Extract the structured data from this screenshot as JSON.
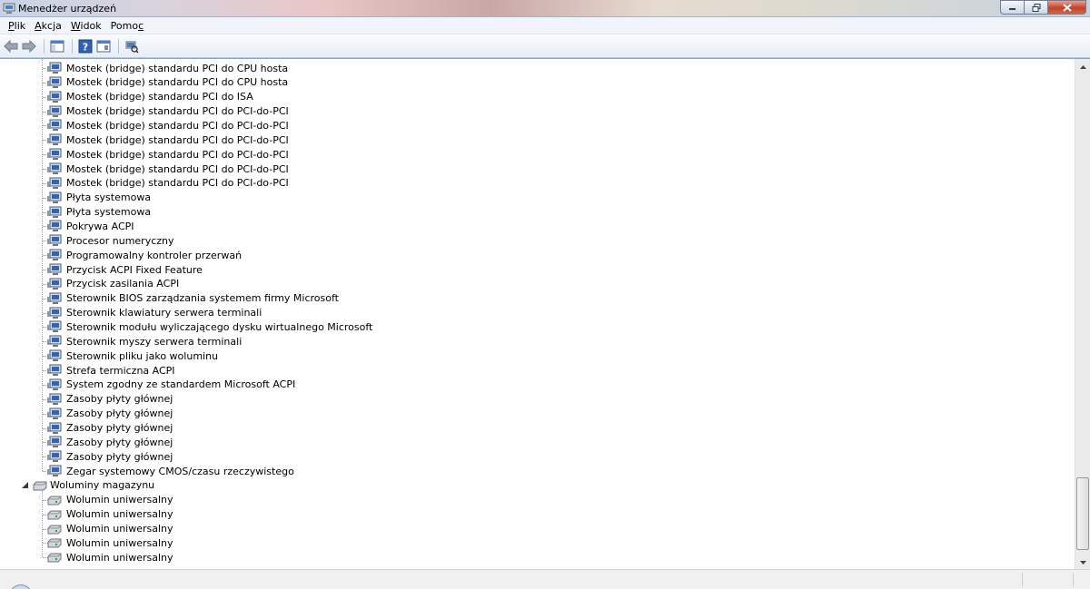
{
  "window": {
    "title": "Menedżer urządzeń",
    "controls": {
      "minimize": "minimize-icon",
      "maximize": "maximize-icon",
      "close": "close-icon"
    }
  },
  "menu": {
    "items": [
      {
        "label": "Plik",
        "accelerator": "P"
      },
      {
        "label": "Akcja",
        "accelerator": "A"
      },
      {
        "label": "Widok",
        "accelerator": "W"
      },
      {
        "label": "Pomoc",
        "accelerator": "c"
      }
    ]
  },
  "toolbar": {
    "buttons": [
      "back-icon",
      "forward-icon",
      "show-hide-tree-icon",
      "help-icon",
      "properties-icon",
      "scan-hardware-icon"
    ]
  },
  "tree": {
    "system_devices": [
      "Mostek (bridge) standardu PCI do CPU hosta",
      "Mostek (bridge) standardu PCI do CPU hosta",
      "Mostek (bridge) standardu PCI do ISA",
      "Mostek (bridge) standardu PCI do PCI-do-PCI",
      "Mostek (bridge) standardu PCI do PCI-do-PCI",
      "Mostek (bridge) standardu PCI do PCI-do-PCI",
      "Mostek (bridge) standardu PCI do PCI-do-PCI",
      "Mostek (bridge) standardu PCI do PCI-do-PCI",
      "Mostek (bridge) standardu PCI do PCI-do-PCI",
      "Płyta systemowa",
      "Płyta systemowa",
      "Pokrywa ACPI",
      "Procesor numeryczny",
      "Programowalny kontroler przerwań",
      "Przycisk ACPI Fixed Feature",
      "Przycisk zasilania ACPI",
      "Sterownik BIOS zarządzania systemem firmy Microsoft",
      "Sterownik klawiatury serwera terminali",
      "Sterownik modułu wyliczającego dysku wirtualnego Microsoft",
      "Sterownik myszy serwera terminali",
      "Sterownik pliku jako woluminu",
      "Strefa termiczna ACPI",
      "System zgodny ze standardem Microsoft ACPI",
      "Zasoby płyty głównej",
      "Zasoby płyty głównej",
      "Zasoby płyty głównej",
      "Zasoby płyty głównej",
      "Zasoby płyty głównej",
      "Zegar systemowy CMOS/czasu rzeczywistego"
    ],
    "category": {
      "label": "Woluminy magazynu",
      "expanded": true,
      "items": [
        "Wolumin uniwersalny",
        "Wolumin uniwersalny",
        "Wolumin uniwersalny",
        "Wolumin uniwersalny",
        "Wolumin uniwersalny"
      ]
    }
  },
  "colors": {
    "menubar_bg": "#f1f5fb",
    "toolbar_border": "#b9c6d9",
    "tree_line": "#a0a0a0"
  }
}
